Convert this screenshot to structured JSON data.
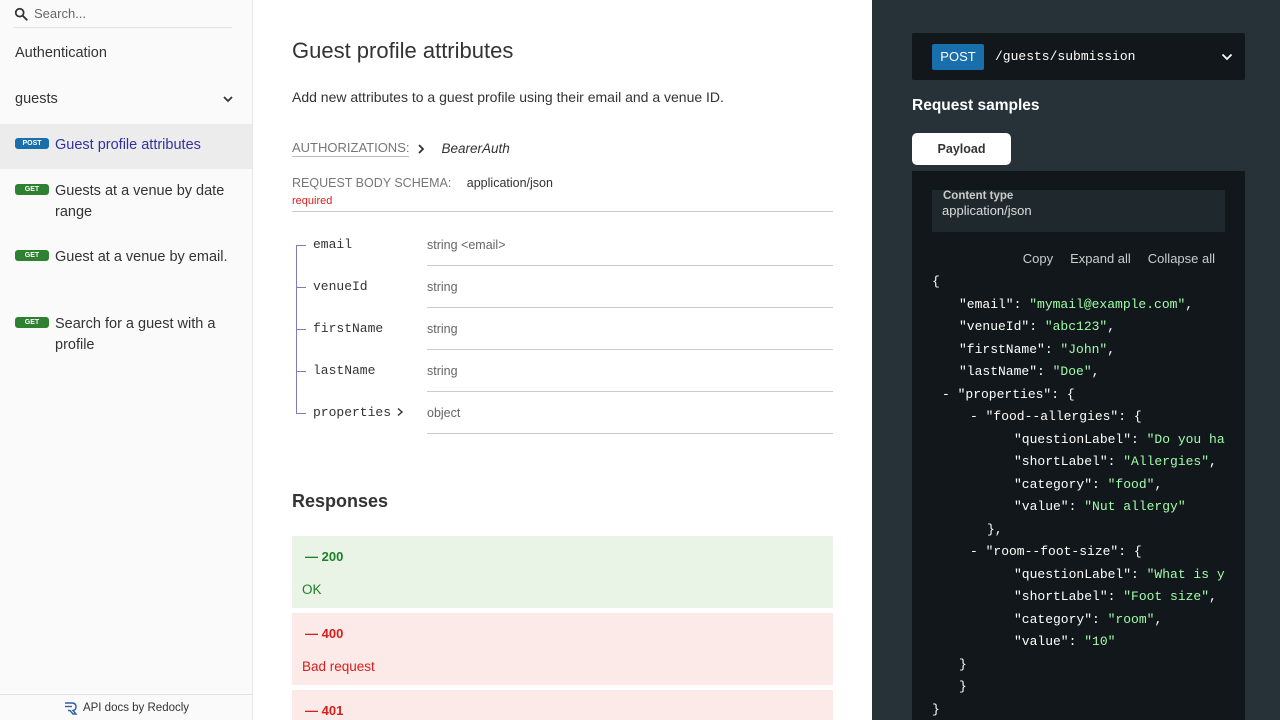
{
  "sidebar": {
    "search_placeholder": "Search...",
    "auth_label": "Authentication",
    "group_label": "guests",
    "operations": [
      {
        "method": "POST",
        "label": "Guest profile attributes"
      },
      {
        "method": "GET",
        "label": "Guests at a venue by date range"
      },
      {
        "method": "GET",
        "label": "Guest at a venue by email."
      },
      {
        "method": "GET",
        "label": "Search for a guest with a profile"
      }
    ],
    "footer": "API docs by Redocly"
  },
  "main": {
    "title": "Guest profile attributes",
    "description": "Add new attributes to a guest profile using their email and a venue ID.",
    "authorizations_label": "AUTHORIZATIONS:",
    "authorizations_value": "BearerAuth",
    "request_body_label": "REQUEST BODY SCHEMA:",
    "request_body_value": "application/json",
    "required_label": "required",
    "fields": [
      {
        "name": "email",
        "type": "string <email>"
      },
      {
        "name": "venueId",
        "type": "string"
      },
      {
        "name": "firstName",
        "type": "string"
      },
      {
        "name": "lastName",
        "type": "string"
      },
      {
        "name": "properties",
        "type": "object"
      }
    ],
    "responses_title": "Responses",
    "responses": [
      {
        "code": "— 200",
        "description": "OK"
      },
      {
        "code": "— 400",
        "description": "Bad request"
      },
      {
        "code": "— 401",
        "description": ""
      }
    ]
  },
  "right": {
    "method": "POST",
    "path": "/guests/submission",
    "request_samples_title": "Request samples",
    "tab_label": "Payload",
    "content_type_label": "Content type",
    "content_type_value": "application/json",
    "actions": [
      "Copy",
      "Expand all",
      "Collapse all"
    ],
    "code_lines": [
      "{",
      "\"email\": \"mymail@example.com\",",
      "\"venueId\": \"abc123\",",
      "\"firstName\": \"John\",",
      "\"lastName\": \"Doe\",",
      "- \"properties\": {",
      "- \"food--allergies\": {",
      "\"questionLabel\": \"Do you ha",
      "\"shortLabel\": \"Allergies\",",
      "\"category\": \"food\",",
      "\"value\": \"Nut allergy\"",
      "},",
      "- \"room--foot-size\": {",
      "\"questionLabel\": \"What is y",
      "\"shortLabel\": \"Foot size\",",
      "\"category\": \"room\",",
      "\"value\": \"10\"",
      "}",
      "}",
      "}"
    ]
  },
  "colors": {
    "post_badge": "#186fab",
    "get_badge": "#2f8132",
    "active_link": "#32329f",
    "string_literal": "#a0fbaa",
    "panel_bg": "#263238"
  }
}
